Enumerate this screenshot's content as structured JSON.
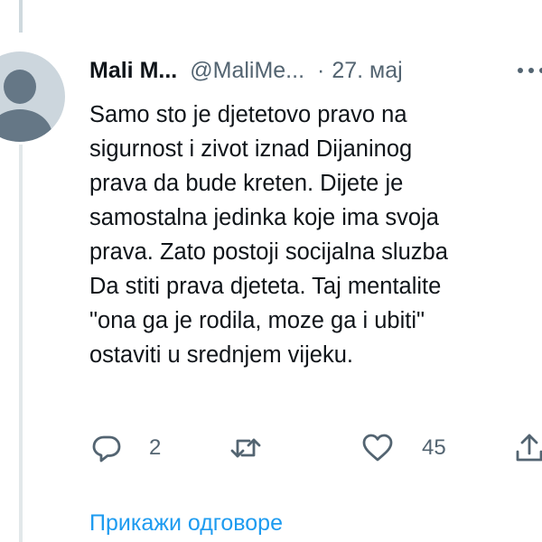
{
  "tweet": {
    "author_name": "Mali M...",
    "handle": "@MaliMe...",
    "separator": "·",
    "date": "27. мај",
    "text_lines": [
      "Samo sto je djetetovo pravo na",
      "sigurnost i zivot iznad Dijaninog",
      "prava da bude kreten. Dijete je",
      "samostalna jedinka koje ima svoja",
      "prava. Zato postoji socijalna sluzba",
      "Da stiti prava djeteta. Taj mentalite",
      "\"ona ga je rodila, moze ga i ubiti\"",
      "ostaviti u srednjem vijeku."
    ],
    "icons": {
      "avatar": "default-avatar-icon",
      "more": "more-icon",
      "reply": "reply-icon",
      "retweet": "retweet-icon",
      "like": "like-icon",
      "share": "share-icon"
    }
  },
  "actions": {
    "reply_count": "2",
    "like_count": "45"
  },
  "footer": {
    "show_replies_label": "Прикажи одговоре"
  },
  "colors": {
    "text": "#0f1419",
    "secondary": "#536471",
    "link": "#1d9bf0",
    "thread_line": "#cfd9de"
  }
}
